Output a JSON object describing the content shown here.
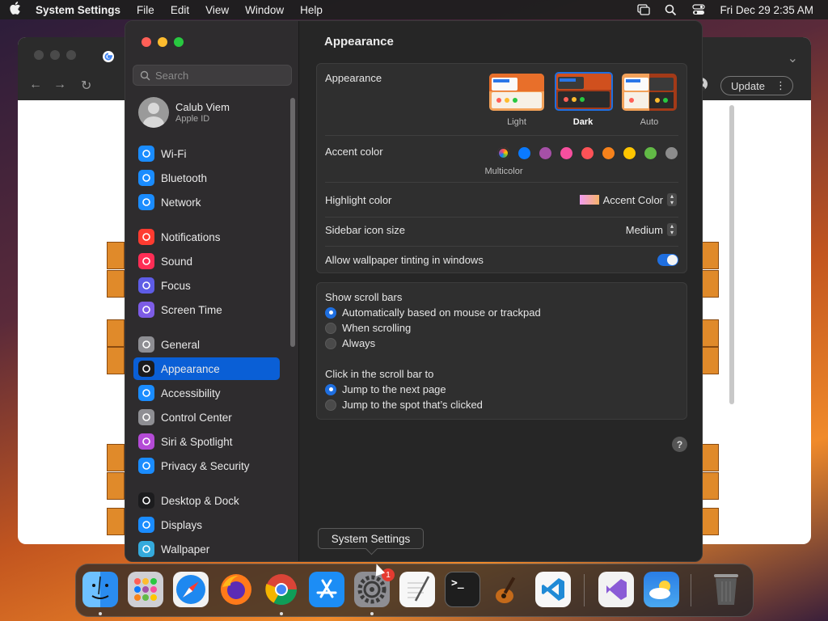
{
  "menubar": {
    "app_name": "System Settings",
    "menus": [
      "File",
      "Edit",
      "View",
      "Window",
      "Help"
    ],
    "datetime": "Fri Dec 29  2:35 AM"
  },
  "browser": {
    "update_label": "Update"
  },
  "settings": {
    "search_placeholder": "Search",
    "profile": {
      "name": "Calub Viem",
      "subtitle": "Apple ID"
    },
    "sidebar_items": [
      {
        "label": "Wi-Fi",
        "icon": "wifi-icon",
        "color": "#1a8cff"
      },
      {
        "label": "Bluetooth",
        "icon": "bluetooth-icon",
        "color": "#1a8cff"
      },
      {
        "label": "Network",
        "icon": "globe-icon",
        "color": "#1a8cff"
      },
      {
        "label": "Notifications",
        "icon": "bell-icon",
        "color": "#ff3b30"
      },
      {
        "label": "Sound",
        "icon": "speaker-icon",
        "color": "#ff2d55"
      },
      {
        "label": "Focus",
        "icon": "moon-icon",
        "color": "#5e5ce6"
      },
      {
        "label": "Screen Time",
        "icon": "hourglass-icon",
        "color": "#7d5ce6"
      },
      {
        "label": "General",
        "icon": "gear-icon",
        "color": "#8e8e93"
      },
      {
        "label": "Appearance",
        "icon": "appearance-icon",
        "color": "#1c1c1e"
      },
      {
        "label": "Accessibility",
        "icon": "accessibility-icon",
        "color": "#1a8cff"
      },
      {
        "label": "Control Center",
        "icon": "control-center-icon",
        "color": "#8e8e93"
      },
      {
        "label": "Siri & Spotlight",
        "icon": "siri-icon",
        "color": "#b44bd6"
      },
      {
        "label": "Privacy & Security",
        "icon": "hand-icon",
        "color": "#1a8cff"
      },
      {
        "label": "Desktop & Dock",
        "icon": "dock-icon",
        "color": "#1c1c1e"
      },
      {
        "label": "Displays",
        "icon": "sun-icon",
        "color": "#1a8cff"
      },
      {
        "label": "Wallpaper",
        "icon": "flower-icon",
        "color": "#34aadc"
      }
    ],
    "selected_item": "Appearance",
    "main": {
      "title": "Appearance",
      "appearance_label": "Appearance",
      "appearance_options": [
        "Light",
        "Dark",
        "Auto"
      ],
      "appearance_selected": "Dark",
      "accent_label": "Accent color",
      "accent_colors": [
        "multicolor",
        "#0a7aff",
        "#a550a7",
        "#f74f9e",
        "#ff5257",
        "#f7821b",
        "#ffc600",
        "#62ba46",
        "#8c8c8c"
      ],
      "accent_selected_name": "Multicolor",
      "highlight_label": "Highlight color",
      "highlight_value": "Accent Color",
      "icon_size_label": "Sidebar icon size",
      "icon_size_value": "Medium",
      "tinting_label": "Allow wallpaper tinting in windows",
      "tinting_on": true,
      "scroll_bars_label": "Show scroll bars",
      "scroll_bar_options": [
        "Automatically based on mouse or trackpad",
        "When scrolling",
        "Always"
      ],
      "scroll_bar_selected": "Automatically based on mouse or trackpad",
      "click_label": "Click in the scroll bar to",
      "click_options": [
        "Jump to the next page",
        "Jump to the spot that’s clicked"
      ],
      "click_selected": "Jump to the next page",
      "help_glyph": "?"
    }
  },
  "tooltip": "System Settings",
  "dock": {
    "apps": [
      "Finder",
      "Launchpad",
      "Safari",
      "Firefox",
      "Chrome",
      "App Store",
      "System Settings",
      "TextEdit",
      "Terminal",
      "GarageBand",
      "Visual Studio Code",
      "Visual Studio",
      "Weather",
      "Trash"
    ],
    "settings_badge": "1"
  }
}
